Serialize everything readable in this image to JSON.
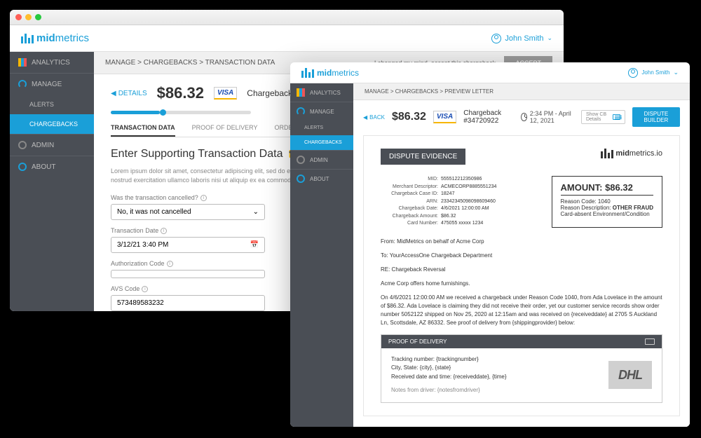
{
  "brand": {
    "name": "midmetrics",
    "name_b": "mid",
    "name_r": "metrics",
    "io": "midmetrics.io"
  },
  "user": {
    "name": "John Smith"
  },
  "sidebar": {
    "analytics": "ANALYTICS",
    "manage": "MANAGE",
    "alerts": "ALERTS",
    "chargebacks": "CHARGEBACKS",
    "admin": "ADMIN",
    "about": "ABOUT"
  },
  "w1": {
    "crumb": "MANAGE > CHARGEBACKS > TRANSACTION DATA",
    "accept_note": "I changed my mind, accept this chargeback.",
    "accept_btn": "ACCEPT",
    "back": "DETAILS",
    "amount": "$86.32",
    "card": "VISA",
    "cbnum": "Chargeback #34720922",
    "tabs": {
      "t1": "TRANSACTION DATA",
      "t2": "PROOF OF DELIVERY",
      "t3": "ORDER DATA"
    },
    "title": "Enter Supporting Transaction Data",
    "lorem": "Lorem ipsum dolor sit amet, consectetur adipiscing elit, sed do eiusmod tempor incididunt ut labore et dolore magna aliqua. Ut enim ad minim veniam, quis nostrud exercitation ullamco laboris nisi ut aliquip ex ea commodo consequat.",
    "f1": {
      "label": "Was the transaction cancelled?",
      "value": "No, it was not cancelled"
    },
    "f2": {
      "label": "Transaction Date",
      "value": "3/12/21 3:40 PM"
    },
    "f3": {
      "label": "Authorization Code",
      "value": ""
    },
    "f4": {
      "label": "AVS Code",
      "value": "573489583232"
    }
  },
  "w2": {
    "crumb": "MANAGE > CHARGEBACKS > PREVIEW LETTER",
    "back": "BACK",
    "amount": "$86.32",
    "card": "VISA",
    "cbnum": "Chargeback #34720922",
    "time": "2:34 PM - April 12, 2021",
    "cb_details": "Show CB Details",
    "dispute_btn": "DISPUTE BUILDER",
    "evidence": "DISPUTE EVIDENCE",
    "meta": {
      "mid_l": "MID:",
      "mid": "555512212350986",
      "md_l": "Merchant Descriptor:",
      "md": "ACMECORP8885551234",
      "cid_l": "Chargeback Case ID:",
      "cid": "18247",
      "arn_l": "ARN:",
      "arn": "23342345098098609460",
      "cdate_l": "Chargeback Date:",
      "cdate": "4/6/2021 12:00:00 AM",
      "camt_l": "Chargeback Amount:",
      "camt": "$86.32",
      "card_l": "Card Number:",
      "card": "475055 xxxxx 1234"
    },
    "amtbox": {
      "label": "AMOUNT:",
      "value": "$86.32",
      "rc_l": "Reason Code: 1040",
      "rd_l": "Reason Description:",
      "rd": "OTHER FRAUD",
      "rd2": "Card-absent Environment/Condition"
    },
    "body": {
      "from": "From: MidMetrics on behalf of Acme Corp",
      "to": "To: YourAccessOne Chargeback Department",
      "re": "RE: Chargeback Reversal",
      "intro": "Acme Corp offers home furnishings.",
      "main": "On 4/6/2021 12:00:00 AM we received a chargeback under Reason Code 1040, from Ada Lovelace in the amount of $86.32. Ada Lovelace is claiming they did not receive their order, yet our customer service records show order number 5052122 shipped on Nov 25, 2020 at 12:15am and was received on {receiveddate} at 2705 S Auckland Ln, Scottsdale, AZ 86332. See proof of delivery from {shippingprovider} below:"
    },
    "pod": {
      "title": "PROOF OF DELIVERY",
      "tracking": "Tracking number: {trackingnumber}",
      "city": "City, State: {city}, {state}",
      "received": "Received date and time: {receiveddate}, {time}",
      "notes": "Notes from driver: {notesfromdriver}",
      "carrier": "DHL"
    }
  }
}
